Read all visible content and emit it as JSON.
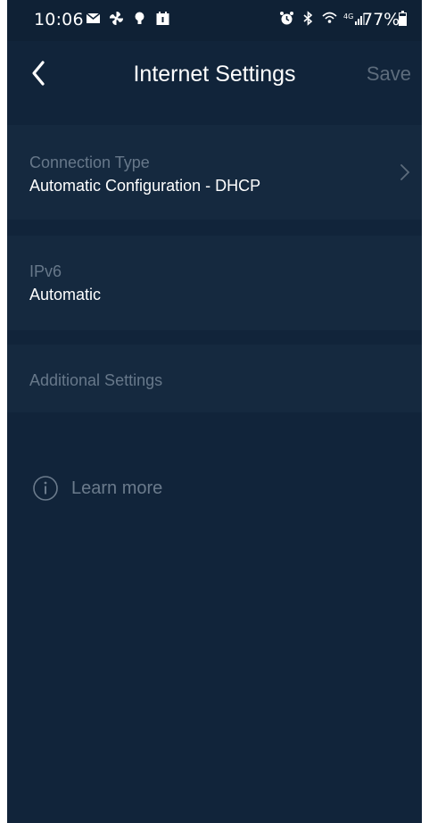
{
  "status_bar": {
    "time": "10:06",
    "battery": "77%",
    "left_icons": [
      "message-icon",
      "pinwheel-icon",
      "bulb-icon",
      "calendar-icon"
    ],
    "right_icons": [
      "alarm-icon",
      "bluetooth-icon",
      "wifi-calling-icon",
      "lte-signal-icon"
    ]
  },
  "header": {
    "title": "Internet Settings",
    "save_label": "Save"
  },
  "connection": {
    "label": "Connection Type",
    "value": "Automatic Configuration - DHCP"
  },
  "ipv6": {
    "label": "IPv6",
    "value": "Automatic"
  },
  "additional": {
    "label": "Additional Settings"
  },
  "learn_more": {
    "label": "Learn more"
  },
  "colors": {
    "background": "#11243a",
    "section": "#15293f",
    "muted_text": "#67788a",
    "primary_text": "#ffffff"
  }
}
